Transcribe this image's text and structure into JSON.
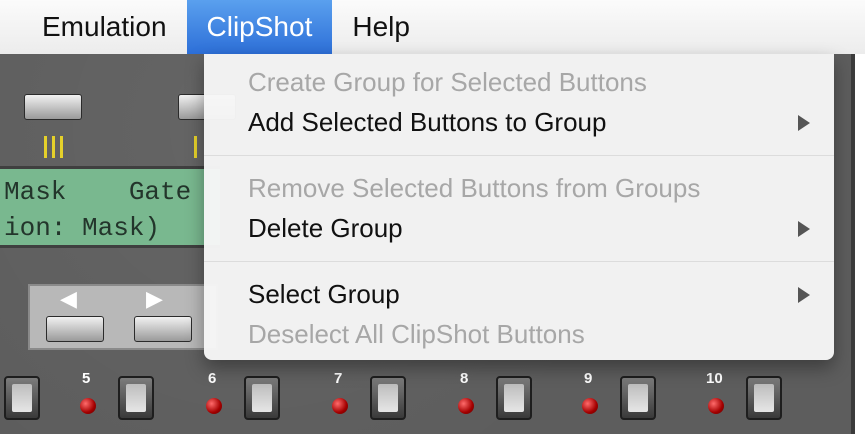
{
  "menubar": {
    "items": [
      {
        "label": "Emulation",
        "active": false
      },
      {
        "label": "ClipShot",
        "active": true
      },
      {
        "label": "Help",
        "active": false
      }
    ]
  },
  "clipshot_menu": {
    "items": [
      {
        "label": "Create Group for Selected Buttons",
        "enabled": false,
        "submenu": false
      },
      {
        "label": "Add Selected Buttons to Group",
        "enabled": true,
        "submenu": true
      },
      {
        "label": "Remove Selected Buttons from Groups",
        "enabled": false,
        "submenu": false
      },
      {
        "label": "Delete Group",
        "enabled": true,
        "submenu": true
      },
      {
        "label": "Select Group",
        "enabled": true,
        "submenu": true
      },
      {
        "label": "Deselect All ClipShot Buttons",
        "enabled": false,
        "submenu": false
      }
    ]
  },
  "lcd": {
    "line1": "Mask    Gate",
    "line2": "ion: Mask)"
  },
  "nav_arrows": {
    "left": "◀",
    "right": "▶"
  },
  "button_numbers": [
    "5",
    "6",
    "7",
    "8",
    "9",
    "10"
  ],
  "colors": {
    "menu_highlight": "#2d6fd8",
    "lcd": "#79b88f",
    "led": "#a40000"
  }
}
